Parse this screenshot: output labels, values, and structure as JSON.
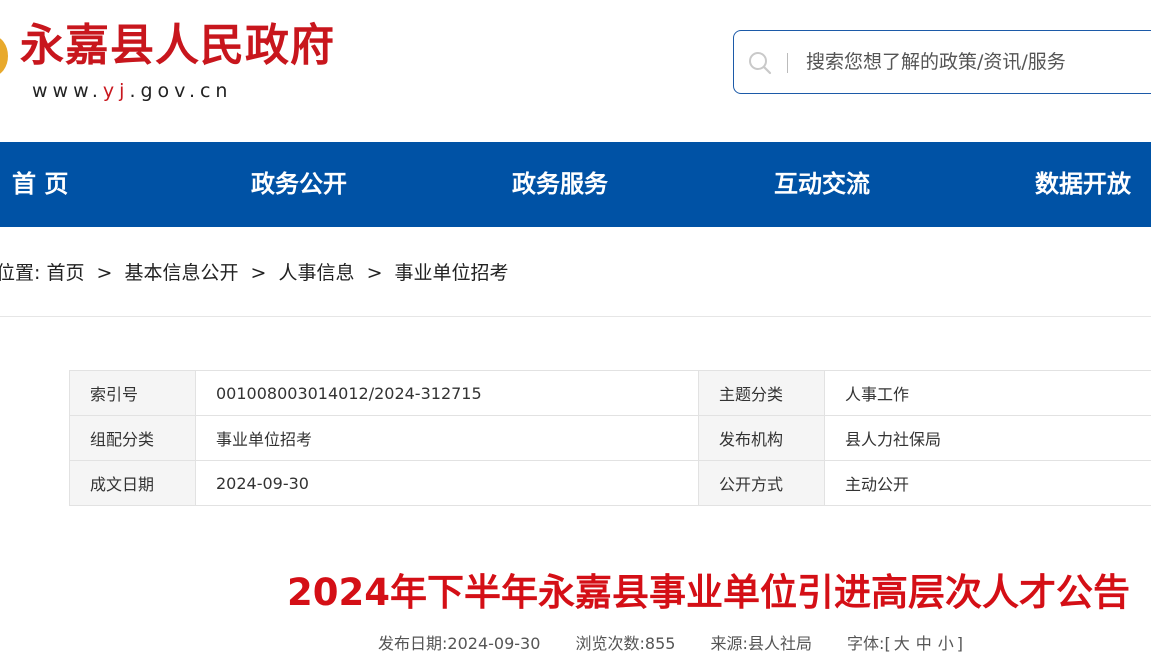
{
  "header": {
    "site_title": "永嘉县人民政府",
    "site_url_pre": "www.",
    "site_url_hl": "yj",
    "site_url_post": ".gov.cn",
    "search_placeholder": "搜索您想了解的政策/资讯/服务",
    "accent": "#c8161d",
    "brand_blue": "#0052a5"
  },
  "nav": {
    "items": [
      "首 页",
      "政务公开",
      "政务服务",
      "互动交流",
      "数据开放"
    ]
  },
  "breadcrumb": {
    "prefix": "位置:",
    "items": [
      "首页",
      "基本信息公开",
      "人事信息",
      "事业单位招考"
    ],
    "separator": ">"
  },
  "info": {
    "rows": [
      {
        "label1": "索引号",
        "value1": "001008003014012/2024-312715",
        "label2": "主题分类",
        "value2": "人事工作"
      },
      {
        "label1": "组配分类",
        "value1": "事业单位招考",
        "label2": "发布机构",
        "value2": "县人力社保局"
      },
      {
        "label1": "成文日期",
        "value1": "2024-09-30",
        "label2": "公开方式",
        "value2": "主动公开"
      }
    ]
  },
  "article": {
    "title": "2024年下半年永嘉县事业单位引进高层次人才公告",
    "publish_label": "发布日期:",
    "publish_date": "2024-09-30",
    "views_label": "浏览次数:",
    "views": "855",
    "source_label": "来源:",
    "source": "县人社局",
    "font_label": "字体:",
    "font_open": "[",
    "font_large": "大",
    "font_medium": "中",
    "font_small": "小",
    "font_close": "]"
  }
}
